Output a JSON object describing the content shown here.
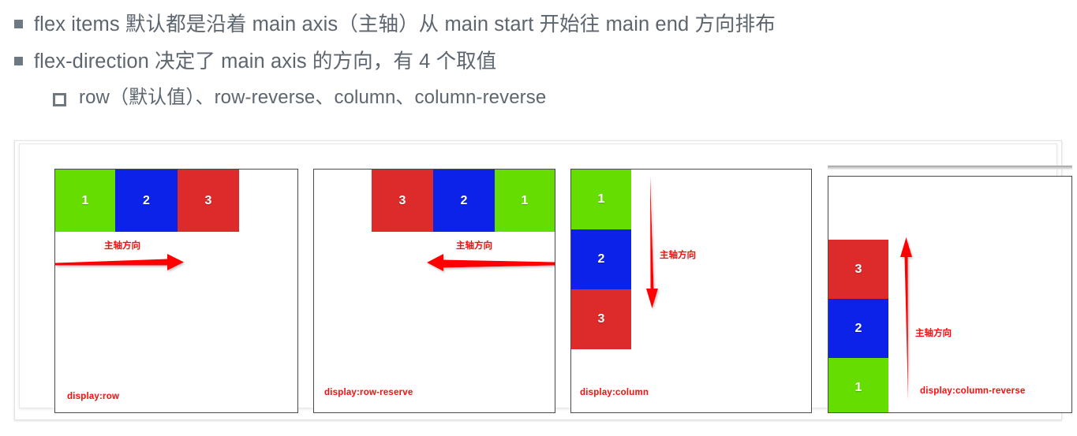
{
  "slide": {
    "bullets": [
      {
        "level": 1,
        "marker": "filled-square-bullet",
        "text": "flex items 默认都是沿着 main axis（主轴）从 main start 开始往 main end 方向排布"
      },
      {
        "level": 1,
        "marker": "filled-square-bullet",
        "text": "flex-direction 决定了 main axis 的方向，有 4 个取值"
      },
      {
        "level": 2,
        "marker": "hollow-square-bullet",
        "text": "row（默认值）、row-reverse、column、column-reverse"
      }
    ]
  },
  "colors": {
    "item1_green": "#66DD00",
    "item2_blue": "#0D22E8",
    "item3_red": "#DD2A2A",
    "annotation_red": "#FF0B0B",
    "bullet_gray": "#6E7880",
    "text_gray": "#5D666F",
    "panel_border": "#4A4A4A"
  },
  "panels": [
    {
      "id": "row",
      "caption": "display:row",
      "axis_label": "主轴方向",
      "axis_direction": "right",
      "items": [
        {
          "label": "1",
          "color": "#66DD00"
        },
        {
          "label": "2",
          "color": "#0D22E8"
        },
        {
          "label": "3",
          "color": "#DD2A2A"
        }
      ]
    },
    {
      "id": "row-reverse",
      "caption": "display:row-reserve",
      "axis_label": "主轴方向",
      "axis_direction": "left",
      "items": [
        {
          "label": "3",
          "color": "#DD2A2A"
        },
        {
          "label": "2",
          "color": "#0D22E8"
        },
        {
          "label": "1",
          "color": "#66DD00"
        }
      ]
    },
    {
      "id": "column",
      "caption": "display:column",
      "axis_label": "主轴方向",
      "axis_direction": "down",
      "items": [
        {
          "label": "1",
          "color": "#66DD00"
        },
        {
          "label": "2",
          "color": "#0D22E8"
        },
        {
          "label": "3",
          "color": "#DD2A2A"
        }
      ]
    },
    {
      "id": "column-reverse",
      "caption": "display:column-reverse",
      "axis_label": "主轴方向",
      "axis_direction": "up",
      "items": [
        {
          "label": "3",
          "color": "#DD2A2A"
        },
        {
          "label": "2",
          "color": "#0D22E8"
        },
        {
          "label": "1",
          "color": "#66DD00"
        }
      ]
    }
  ]
}
